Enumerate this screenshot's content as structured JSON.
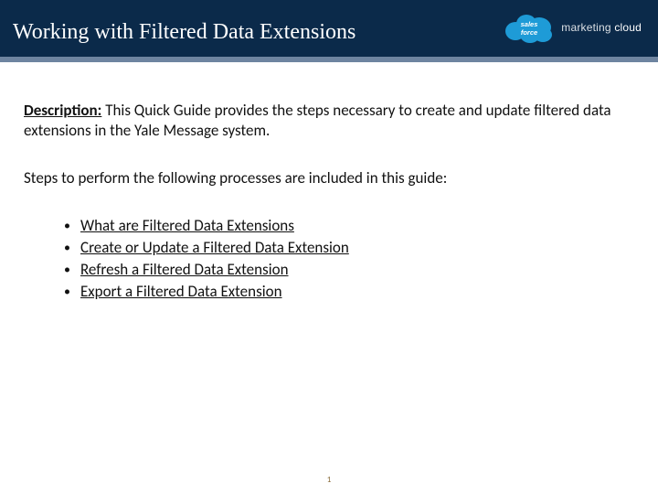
{
  "header": {
    "title": "Working with Filtered Data Extensions",
    "logo_brand_top": "sales",
    "logo_brand_bottom": "force",
    "logo_text_1": "marketing",
    "logo_text_2": "cloud"
  },
  "body": {
    "desc_label": "Description:",
    "desc_text": " This Quick Guide provides the steps necessary to create and update filtered data extensions in the Yale Message system.",
    "steps_intro": "Steps to perform the following processes are included in this guide:",
    "links": [
      "What are Filtered Data Extensions",
      "Create or Update a Filtered Data Extension",
      "Refresh a Filtered Data Extension",
      "Export a Filtered Data Extension"
    ]
  },
  "page_number": "1"
}
